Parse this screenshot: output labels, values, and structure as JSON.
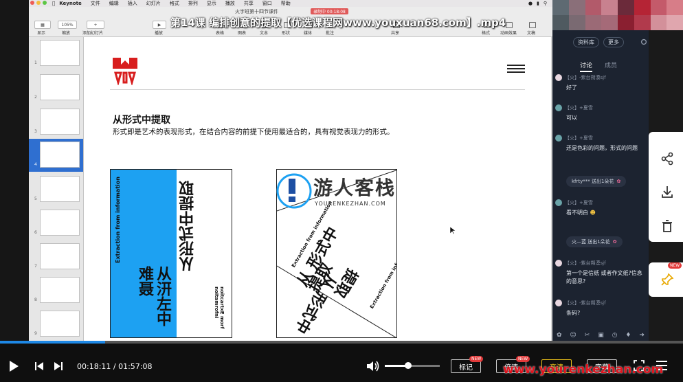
{
  "menubar": {
    "app": "Keynote",
    "items": [
      "文件",
      "编辑",
      "插入",
      "幻灯片",
      "格式",
      "排列",
      "显示",
      "播放",
      "共享",
      "窗口",
      "帮助"
    ]
  },
  "toolbar": {
    "doc_title": "火字班第十四节课件",
    "rec": "录制中 00:18:08",
    "zoom": "105%",
    "labels": {
      "view": "显示",
      "zoom": "缩放",
      "add_slide": "添加幻灯片",
      "play": "播放",
      "table": "表格",
      "chart": "图表",
      "text": "文本",
      "shape": "形状",
      "media": "媒体",
      "comment": "批注",
      "share": "共享",
      "format": "格式",
      "animate": "动画效果",
      "document": "文稿"
    }
  },
  "video_title": "第14课 编排创意的提取【优选课程网www.youxuan68.com】.mp4",
  "navigator": {
    "numbers": [
      "1",
      "2",
      "3",
      "4",
      "5",
      "6",
      "7",
      "8",
      "9",
      "10"
    ],
    "active_index": 3
  },
  "slide": {
    "heading": "从形式中提取",
    "subtitle": "形式即是艺术的表现形式，在结合内容的前提下使用最适合的，具有视觉表现力的形式。",
    "card1": {
      "en": "Extraction from information",
      "cn_top": "从形式中提取",
      "cn_bottom": "从汧左中 难聂",
      "en_bottom": "noitcartxE morf noitamrofni"
    },
    "card2": {
      "line1": "从 形式中",
      "line2": "提取",
      "line3": "从 形式中",
      "line4": "提取",
      "en1": "Extraction from information",
      "en2": "Extraction from information"
    }
  },
  "watermark": {
    "cn": "游人客栈",
    "url": "YOURENKEZHAN.COM"
  },
  "chat": {
    "top_buttons": [
      "资料库",
      "更多"
    ],
    "tabs": [
      "讨论",
      "成员"
    ],
    "messages": [
      {
        "who": "【火】-紫台朔漠sjf",
        "text": "好了"
      },
      {
        "who": "【火】+夏雪",
        "text": "可以"
      },
      {
        "who": "【火】+夏雪",
        "text": "还是色彩的问题，形式的问题"
      },
      {
        "who": "【火】+夏雪",
        "text": "看不明白"
      },
      {
        "who": "【火】-紫台朔漠sjf",
        "text": "第一个是信纸 或者作文纸?信息的意思?"
      },
      {
        "who": "【火】-紫台朔漠sjf",
        "text": "条码?"
      }
    ],
    "gifts": [
      "kfrty*** 送出1朵花",
      "火—蓝 送出1朵花"
    ]
  },
  "side": {
    "new_label": "NEW"
  },
  "player": {
    "time": "00:18:11 / 01:57:08",
    "btn_mark": "标记",
    "btn_speed": "倍速",
    "btn_quality": "高清",
    "btn_subtitle": "字幕",
    "new": "NEW",
    "progress": 0.154,
    "volume": 0.42
  },
  "site_watermark": "www.yourenkezhan.com",
  "colors": {
    "accent_blue": "#1da1f2",
    "logo_red": "#d81e1e",
    "progress": "#1e88e5",
    "chat_bg": "#1c2330"
  }
}
